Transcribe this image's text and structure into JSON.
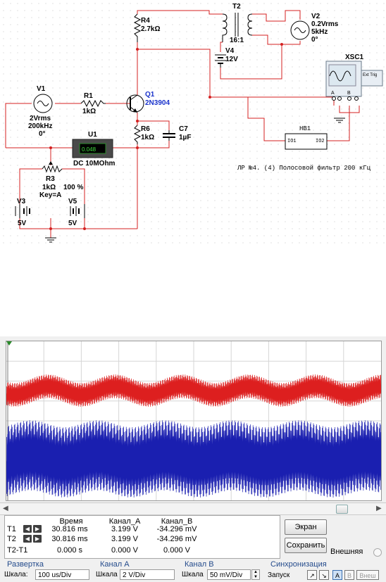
{
  "schematic": {
    "r4": {
      "name": "R4",
      "value": "2.7kΩ"
    },
    "t2": {
      "name": "T2",
      "ratio": "16:1"
    },
    "v2": {
      "name": "V2",
      "line1": "0.2Vrms",
      "line2": "5kHz",
      "line3": "0°"
    },
    "v4": {
      "name": "V4",
      "value": "12V"
    },
    "xsc": {
      "name": "XSC1",
      "ext_trig": "Ext Trig",
      "a": "A",
      "b": "B"
    },
    "v1": {
      "name": "V1",
      "line1": "2Vrms",
      "line2": "200kHz",
      "line3": "0°"
    },
    "r1": {
      "name": "R1",
      "value": "1kΩ"
    },
    "q1": {
      "name": "Q1",
      "model": "2N3904"
    },
    "u1": {
      "name": "U1",
      "display": "0.048",
      "mode": "DC  10MOhm"
    },
    "r6": {
      "name": "R6",
      "value": "1kΩ"
    },
    "c7": {
      "name": "C7",
      "value": "1µF"
    },
    "hb1": {
      "name": "HB1",
      "pin1": "IO1",
      "pin2": "IO2"
    },
    "caption": "ЛР №4. (4) Полосовой фильтр 200 кГц",
    "r3": {
      "name": "R3",
      "value": "1kΩ",
      "percent": "100 %",
      "key": "Key=A"
    },
    "v3": {
      "name": "V3",
      "value": "5V"
    },
    "v5": {
      "name": "V5",
      "value": "5V"
    }
  },
  "oscilloscope": {
    "readout": {
      "headers": [
        "Время",
        "Канал_A",
        "Канал_B"
      ],
      "rows": [
        {
          "label": "T1",
          "time": "30.816 ms",
          "a": "3.199 V",
          "b": "-34.296 mV"
        },
        {
          "label": "T2",
          "time": "30.816 ms",
          "a": "3.199 V",
          "b": "-34.296 mV"
        },
        {
          "label": "T2-T1",
          "time": "0.000 s",
          "a": "0.000 V",
          "b": "0.000 V"
        }
      ]
    },
    "buttons": {
      "screen": "Экран",
      "save": "Сохранить",
      "external": "Внешняя"
    },
    "timebase": {
      "title": "Развертка",
      "scale_label": "Шкала:",
      "scale_value": "100 us/Div"
    },
    "channel_a": {
      "title": "Канал A",
      "scale_label": "Шкала",
      "scale_value": "2  V/Div"
    },
    "channel_b": {
      "title": "Канал B",
      "scale_label": "Шкала",
      "scale_value": "50 mV/Div"
    },
    "sync": {
      "title": "Синхронизация",
      "trigger_label": "Запуск",
      "opt_a": "A",
      "opt_b": "B",
      "opt_ext": "Внеш"
    },
    "colors": {
      "channel_a": "#dd1f1f",
      "channel_b": "#1a1fb0"
    }
  }
}
